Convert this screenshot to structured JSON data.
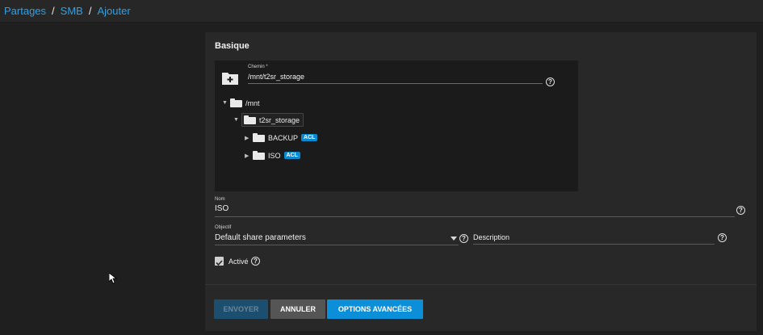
{
  "breadcrumb": {
    "items": [
      "Partages",
      "SMB",
      "Ajouter"
    ],
    "separator": "/"
  },
  "card": {
    "title": "Basique"
  },
  "explorer": {
    "path_label": "Chemin *",
    "path_value": "/mnt/t2sr_storage",
    "tree": [
      {
        "label": "/mnt",
        "expanded": true
      },
      {
        "label": "t2sr_storage",
        "expanded": true,
        "selected": true
      },
      {
        "label": "BACKUP",
        "badge": "ACL",
        "expanded": false
      },
      {
        "label": "ISO",
        "badge": "ACL",
        "expanded": false
      }
    ]
  },
  "form": {
    "name_label": "Nom",
    "name_value": "ISO",
    "purpose_label": "Objectif",
    "purpose_value": "Default share parameters",
    "description_label": "Description",
    "description_value": "",
    "enabled_label": "Activé",
    "enabled_checked": true
  },
  "buttons": {
    "submit": "ENVOYER",
    "cancel": "ANNULER",
    "advanced": "OPTIONS AVANCÉES"
  },
  "icons": {
    "help": "help-circle-icon",
    "folder": "folder-icon",
    "folder_add": "folder-add-icon",
    "check": "checkmark-icon"
  },
  "colors": {
    "accent": "#0a8fd8",
    "link": "#2fa1e6",
    "badge": "#0b8ad0"
  }
}
